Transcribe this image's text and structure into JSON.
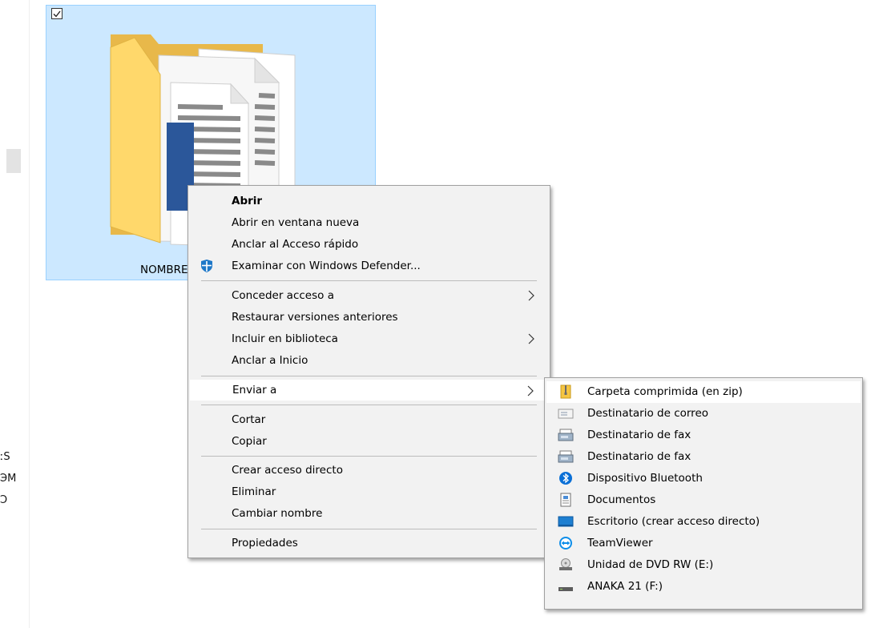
{
  "sidebar": {
    "fragments": [
      "ːS",
      "ЭM",
      "Ͻ"
    ]
  },
  "folder": {
    "name": "NOMBRE"
  },
  "context_menu": {
    "items": [
      {
        "label": "Abrir"
      },
      {
        "label": "Abrir en ventana nueva"
      },
      {
        "label": "Anclar al Acceso rápido"
      },
      {
        "label": "Examinar con Windows Defender..."
      },
      {
        "label": "Conceder acceso a"
      },
      {
        "label": "Restaurar versiones anteriores"
      },
      {
        "label": "Incluir en biblioteca"
      },
      {
        "label": "Anclar a Inicio"
      },
      {
        "label": "Enviar a"
      },
      {
        "label": "Cortar"
      },
      {
        "label": "Copiar"
      },
      {
        "label": "Crear acceso directo"
      },
      {
        "label": "Eliminar"
      },
      {
        "label": "Cambiar nombre"
      },
      {
        "label": "Propiedades"
      }
    ]
  },
  "send_to_menu": {
    "items": [
      {
        "label": "Carpeta comprimida (en zip)",
        "icon": "zip-folder-icon"
      },
      {
        "label": "Destinatario de correo",
        "icon": "mail-icon"
      },
      {
        "label": "Destinatario de fax",
        "icon": "fax-icon"
      },
      {
        "label": "Destinatario de fax",
        "icon": "fax-icon"
      },
      {
        "label": "Dispositivo Bluetooth",
        "icon": "bluetooth-icon"
      },
      {
        "label": "Documentos",
        "icon": "documents-icon"
      },
      {
        "label": "Escritorio (crear acceso directo)",
        "icon": "desktop-icon"
      },
      {
        "label": "TeamViewer",
        "icon": "teamviewer-icon"
      },
      {
        "label": "Unidad de DVD RW (E:)",
        "icon": "dvd-drive-icon"
      },
      {
        "label": "ANAKA 21 (F:)",
        "icon": "usb-drive-icon"
      }
    ]
  },
  "colors": {
    "selection_bg": "#cce8ff",
    "menu_bg": "#f2f2f2",
    "word_blue": "#2b579a",
    "folder_yellow": "#ffd86b"
  }
}
